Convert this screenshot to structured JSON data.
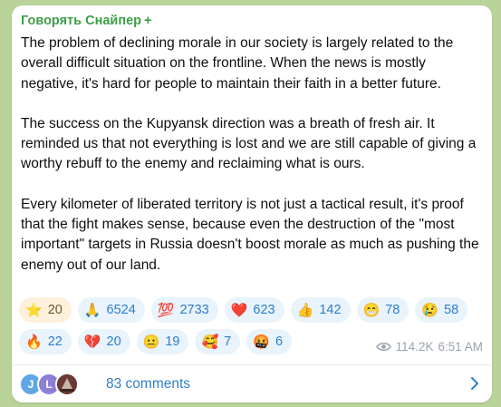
{
  "channel": {
    "name": "Говорять Снайпер",
    "badge": "+"
  },
  "message": {
    "paragraphs": [
      "The problem of declining morale in our society is largely related to the overall difficult situation on the frontline. When the news is mostly negative, it's hard for people to maintain their faith in a better future.",
      "The success on the Kupyansk direction was a breath of fresh air. It reminded us that not everything is lost and we are still capable of giving a worthy rebuff to the enemy and reclaiming what is ours.",
      "Every kilometer of liberated territory is not just a tactical result, it's proof that the fight makes sense, because even the destruction of the \"most important\" targets in Russia doesn't boost morale as much as pushing the enemy out of our land."
    ]
  },
  "reactions": {
    "row1": [
      {
        "emoji": "⭐",
        "icon": "star-icon",
        "count": "20"
      },
      {
        "emoji": "🙏",
        "icon": "praying-hands-icon",
        "count": "6524"
      },
      {
        "emoji": "💯",
        "icon": "hundred-points-icon",
        "count": "2733"
      },
      {
        "emoji": "❤️",
        "icon": "red-heart-icon",
        "count": "623"
      },
      {
        "emoji": "👍",
        "icon": "thumbs-up-icon",
        "count": "142"
      },
      {
        "emoji": "😁",
        "icon": "beaming-face-icon",
        "count": "78"
      },
      {
        "emoji": "😢",
        "icon": "crying-face-icon",
        "count": "58"
      }
    ],
    "row2": [
      {
        "emoji": "🔥",
        "icon": "fire-icon",
        "count": "22"
      },
      {
        "emoji": "💔",
        "icon": "broken-heart-icon",
        "count": "20"
      },
      {
        "emoji": "😐",
        "icon": "neutral-face-icon",
        "count": "19"
      },
      {
        "emoji": "🥰",
        "icon": "smiling-hearts-face-icon",
        "count": "7"
      },
      {
        "emoji": "🤬",
        "icon": "cursing-face-icon",
        "count": "6"
      }
    ]
  },
  "meta": {
    "views": "114.2K",
    "time": "6:51 AM"
  },
  "comments": {
    "label": "83 comments",
    "avatars": [
      "J",
      "L",
      ""
    ]
  },
  "colors": {
    "background": "#b9d39a",
    "channel_name": "#3e9e48",
    "link": "#2f7ec9",
    "reaction_bg": "#e8f3fc",
    "reaction_active_bg": "#fdf1dc"
  }
}
